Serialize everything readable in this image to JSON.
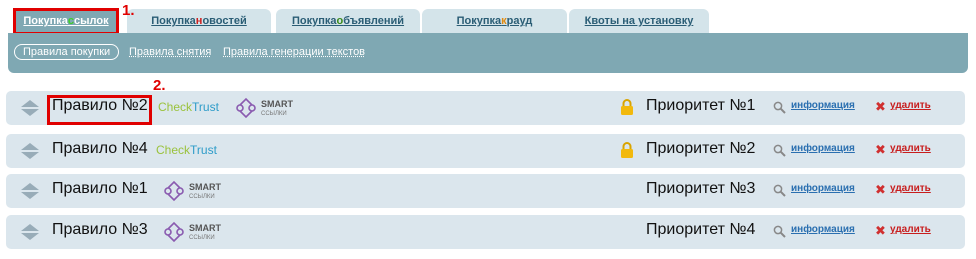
{
  "tabs": [
    {
      "pre": "Покупка ",
      "hl": "с",
      "post": "сылок",
      "hl_color": "green",
      "active": true
    },
    {
      "pre": "Покупка ",
      "hl": "н",
      "post": "овостей",
      "hl_color": "red",
      "active": false
    },
    {
      "pre": "Покупка ",
      "hl": "о",
      "post": "бъявлений",
      "hl_color": "green",
      "active": false
    },
    {
      "pre": "Покупка ",
      "hl": "к",
      "post": "рауд",
      "hl_color": "orange",
      "active": false
    },
    {
      "pre": "Квоты на установку",
      "hl": "",
      "post": "",
      "hl_color": "",
      "active": false
    }
  ],
  "subtabs": [
    "Правила покупки",
    "Правила снятия",
    "Правила генерации текстов"
  ],
  "annotations": [
    "1.",
    "2."
  ],
  "colors": {
    "tab_active": "#7fa8b3",
    "tab_inactive": "#d4e4ea",
    "row_bg": "#dbe6ed",
    "annotation": "#e00000"
  },
  "brand": {
    "check_a": "Check",
    "check_b": "Trust",
    "smart_a": "SMART",
    "smart_b": "ССЫЛКИ"
  },
  "actions": {
    "info": "информация",
    "delete": "удалить"
  },
  "rules": [
    {
      "name": "Правило №2",
      "checktrust": true,
      "smart": true,
      "locked": true,
      "priority": "Приоритет №1"
    },
    {
      "name": "Правило №4",
      "checktrust": true,
      "smart": false,
      "locked": true,
      "priority": "Приоритет №2"
    },
    {
      "name": "Правило №1",
      "checktrust": false,
      "smart": true,
      "locked": false,
      "priority": "Приоритет №3"
    },
    {
      "name": "Правило №3",
      "checktrust": false,
      "smart": true,
      "locked": false,
      "priority": "Приоритет №4"
    }
  ]
}
